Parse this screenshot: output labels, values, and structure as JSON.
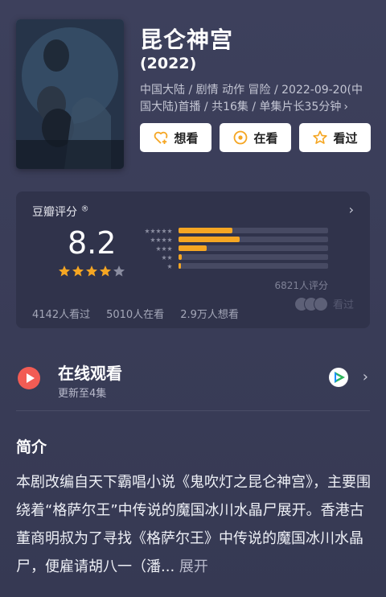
{
  "movie": {
    "title": "昆仑神宫",
    "year": "(2022)",
    "meta": "中国大陆 / 剧情 动作 冒险 / 2022-09-20(中国大陆)首播 / 共16集 / 单集片长35分钟",
    "poster_title_glyphs": "昆仑神宫"
  },
  "actions": {
    "want": "想看",
    "watching": "在看",
    "watched": "看过"
  },
  "rating": {
    "title": "豆瓣评分",
    "registered": "®",
    "score": "8.2",
    "stars": 4,
    "distribution": [
      0.36,
      0.41,
      0.19,
      0.02,
      0.01
    ],
    "count": "6821人评分",
    "stats": [
      "4142人看过",
      "5010人在看",
      "2.9万人想看"
    ],
    "friends_watched": "看过"
  },
  "watch": {
    "title": "在线观看",
    "subtitle": "更新至4集"
  },
  "intro": {
    "title": "简介",
    "text": "本剧改编自天下霸唱小说《鬼吹灯之昆仑神宫》，主要围绕着“格萨尔王”中传说的魔国冰川水晶尸展开。香港古董商明叔为了寻找《格萨尔王》中传说的魔国冰川水晶尸，便雇请胡八一（潘...",
    "expand": "展开"
  },
  "colors": {
    "background": "#3a3d58",
    "card": "#30334b",
    "accent": "#f5a623",
    "play": "#f25c54"
  },
  "icons": [
    "heart-plus-icon",
    "circle-dot-icon",
    "star-icon",
    "chevron-right-icon",
    "play-icon",
    "tencent-video-icon"
  ]
}
